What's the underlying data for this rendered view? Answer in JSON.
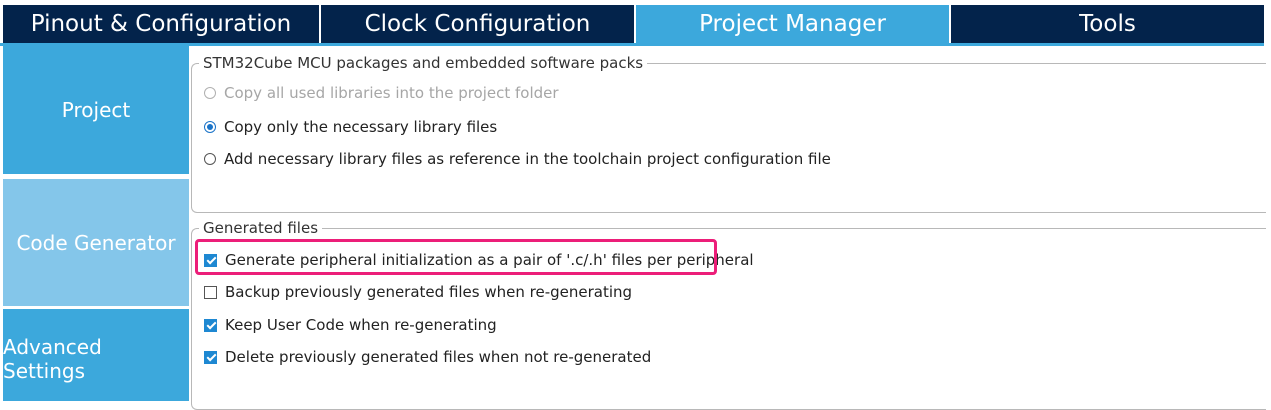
{
  "tabs": [
    {
      "label": "Pinout & Configuration",
      "active": false
    },
    {
      "label": "Clock Configuration",
      "active": false
    },
    {
      "label": "Project Manager",
      "active": true
    },
    {
      "label": "Tools",
      "active": false
    }
  ],
  "sidebar": {
    "items": [
      {
        "label": "Project"
      },
      {
        "label": "Code Generator",
        "selected": true
      },
      {
        "label": "Advanced Settings"
      }
    ]
  },
  "packages_group": {
    "legend": "STM32Cube MCU packages and embedded software packs",
    "options": [
      {
        "label": "Copy all used libraries into the project folder",
        "selected": false,
        "disabled": true
      },
      {
        "label": "Copy only the necessary library files",
        "selected": true,
        "disabled": false
      },
      {
        "label": "Add necessary library files as reference in the toolchain project configuration file",
        "selected": false,
        "disabled": false
      }
    ]
  },
  "generated_group": {
    "legend": "Generated files",
    "options": [
      {
        "label": "Generate peripheral initialization as a pair of '.c/.h' files per peripheral",
        "checked": true,
        "highlighted": true
      },
      {
        "label": "Backup previously generated files when re-generating",
        "checked": false
      },
      {
        "label": "Keep User Code when re-generating",
        "checked": true
      },
      {
        "label": "Delete previously generated files when not re-generated",
        "checked": true
      }
    ]
  },
  "colors": {
    "tab_dark": "#03234b",
    "tab_active": "#3ca8dc",
    "sidebar_dark": "#3ca8dc",
    "sidebar_selected": "#84c6ea",
    "highlight": "#ec1e79"
  }
}
